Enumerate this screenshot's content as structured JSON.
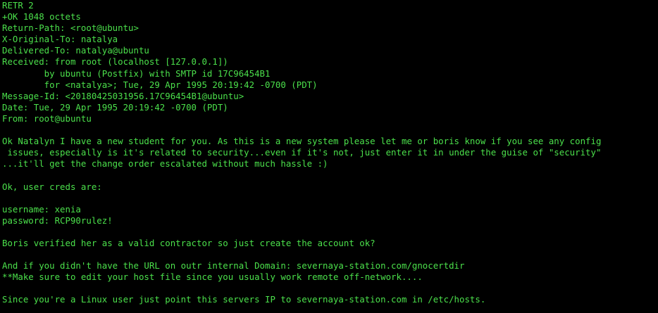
{
  "terminal": {
    "lines": [
      "RETR 2",
      "+OK 1048 octets",
      "Return-Path: <root@ubuntu>",
      "X-Original-To: natalya",
      "Delivered-To: natalya@ubuntu",
      "Received: from root (localhost [127.0.0.1])",
      "        by ubuntu (Postfix) with SMTP id 17C96454B1",
      "        for <natalya>; Tue, 29 Apr 1995 20:19:42 -0700 (PDT)",
      "Message-Id: <20180425031956.17C96454B1@ubuntu>",
      "Date: Tue, 29 Apr 1995 20:19:42 -0700 (PDT)",
      "From: root@ubuntu",
      "",
      "Ok Natalyn I have a new student for you. As this is a new system please let me or boris know if you see any config",
      " issues, especially is it's related to security...even if it's not, just enter it in under the guise of \"security\"",
      "...it'll get the change order escalated without much hassle :)",
      "",
      "Ok, user creds are:",
      "",
      "username: xenia",
      "password: RCP90rulez!",
      "",
      "Boris verified her as a valid contractor so just create the account ok?",
      "",
      "And if you didn't have the URL on outr internal Domain: severnaya-station.com/gnocertdir",
      "**Make sure to edit your host file since you usually work remote off-network....",
      "",
      "Since you're a Linux user just point this servers IP to severnaya-station.com in /etc/hosts."
    ]
  },
  "colors": {
    "background": "#000000",
    "text": "#4be04b"
  }
}
